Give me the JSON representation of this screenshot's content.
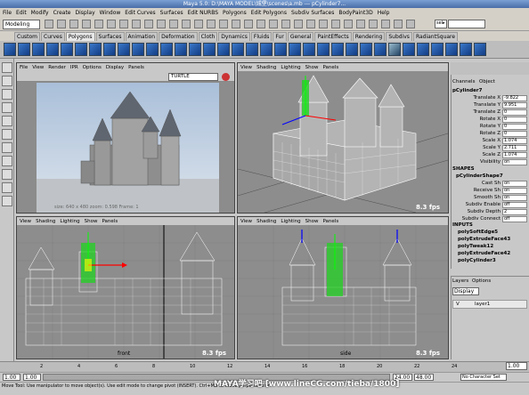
{
  "window": {
    "title": "Maya 5.0: D:\\MAYA MODEL\\城堡\\scenes\\a.mb  ---  pCylinder7..."
  },
  "menubar": [
    "File",
    "Edit",
    "Modify",
    "Create",
    "Display",
    "Window",
    "Edit Curves",
    "Surfaces",
    "Edit NURBS",
    "Polygons",
    "Edit Polygons",
    "Subdiv Surfaces",
    "BodyPaint3D",
    "Help"
  ],
  "statusline": {
    "mode": "Modeling",
    "sel_label": "sel▸"
  },
  "shelf_tabs": [
    "Custom",
    "Curves",
    "Polygons",
    "Surfaces",
    "Animation",
    "Deformation",
    "Cloth",
    "Dynamics",
    "Fluids",
    "Fur",
    "General",
    "PaintEffects",
    "Rendering",
    "Subdivs",
    "RadiantSquare"
  ],
  "shelf_active_tab": "Polygons",
  "render_view": {
    "menu": [
      "File",
      "View",
      "Render",
      "IPR",
      "Options",
      "Display",
      "Panels"
    ],
    "renderer": "TURTLE",
    "info": "size: 640 x 480  zoom: 0.598  Frame: 1"
  },
  "persp_view": {
    "menu": [
      "View",
      "Shading",
      "Lighting",
      "Show",
      "Panels"
    ],
    "fps": "8.3 fps"
  },
  "front_view": {
    "menu": [
      "View",
      "Shading",
      "Lighting",
      "Show",
      "Panels"
    ],
    "fps": "8.3 fps",
    "camera": "front"
  },
  "side_view": {
    "menu": [
      "View",
      "Shading",
      "Lighting",
      "Show",
      "Panels"
    ],
    "fps": "8.3 fps",
    "camera": "side"
  },
  "channel_box": {
    "tabs": [
      "Channels",
      "Object"
    ],
    "object": "pCylinder7",
    "attributes": [
      {
        "label": "Translate X",
        "value": "-9.822"
      },
      {
        "label": "Translate Y",
        "value": "9.951"
      },
      {
        "label": "Translate Z",
        "value": "0"
      },
      {
        "label": "Rotate X",
        "value": "0"
      },
      {
        "label": "Rotate Y",
        "value": "0"
      },
      {
        "label": "Rotate Z",
        "value": "0"
      },
      {
        "label": "Scale X",
        "value": "1.074"
      },
      {
        "label": "Scale Y",
        "value": "2.711"
      },
      {
        "label": "Scale Z",
        "value": "1.074"
      },
      {
        "label": "Visibility",
        "value": "on"
      }
    ],
    "shapes_header": "SHAPES",
    "shape_name": "pCylinderShape7",
    "shape_attributes": [
      {
        "label": "Cast Sh",
        "value": "on"
      },
      {
        "label": "Receive Sh",
        "value": "on"
      },
      {
        "label": "Smooth Sh",
        "value": "on"
      },
      {
        "label": "Subdiv Enable",
        "value": "off"
      },
      {
        "label": "Subdiv Depth",
        "value": "2"
      },
      {
        "label": "Subdiv Connect",
        "value": "off"
      }
    ],
    "inputs_header": "INPUTS",
    "inputs": [
      "polySoftEdge5",
      "polyExtrudeFace43",
      "polyTweak12",
      "polyExtrudeFace42",
      "polyCylinder3"
    ]
  },
  "layer_editor": {
    "tabs": [
      "Layers",
      "Options"
    ],
    "mode": "Display",
    "layers": [
      {
        "visible": "V",
        "name": "layer1"
      }
    ]
  },
  "time": {
    "ticks": [
      "2",
      "4",
      "6",
      "8",
      "10",
      "12",
      "14",
      "16",
      "18",
      "20",
      "22",
      "24"
    ],
    "current": "1.00",
    "start": "1.00",
    "range_start": "1.00",
    "range_end": "24.00",
    "end": "48.00",
    "character_set": "No Character Set"
  },
  "help_line": "Move Tool: Use manipulator to move object(s). Use edit mode to change pivot (INSERT). Ctrl+MB to move perpendicular.",
  "watermark": "MAYA学习吧  [www.lineCG.com/tieba/1800]",
  "colors": {
    "title_bg": "#4a6ea8",
    "viewport_bg": "#8d8d8d",
    "wire": "#ffffff",
    "manip_y": "#00ff00",
    "manip_x": "#ff0000",
    "manip_z": "#0000ff"
  }
}
